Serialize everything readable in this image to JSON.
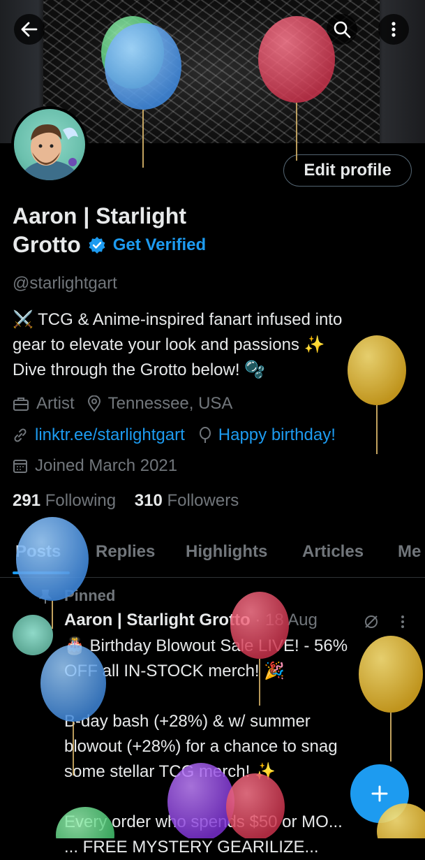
{
  "header": {
    "back_icon": "arrow-left-icon",
    "search_icon": "search-icon",
    "more_icon": "more-vertical-icon"
  },
  "profile": {
    "edit_label": "Edit profile",
    "name_line1": "Aaron | Starlight",
    "name_line2": "Grotto",
    "get_verified": "Get Verified",
    "handle": "@starlightgart",
    "bio": [
      "⚔️ TCG & Anime-inspired fanart infused into",
      "gear to elevate your look and passions ✨",
      "Dive through the Grotto below! 🫧"
    ],
    "occupation": "Artist",
    "location": "Tennessee, USA",
    "website": "linktr.ee/starlightgart",
    "birthday": "Happy birthday!",
    "joined": "Joined March 2021",
    "following_count": "291",
    "following_label": "Following",
    "followers_count": "310",
    "followers_label": "Followers"
  },
  "tabs": [
    "Posts",
    "Replies",
    "Highlights",
    "Articles",
    "Me"
  ],
  "active_tab": "Posts",
  "pinned_post": {
    "pinned_label": "Pinned",
    "author": "Aaron | Starlight Grotto",
    "date": "· 18 Aug",
    "text": "🎂 Birthday Blowout Sale LIVE! - 56%\nOFF all IN-STOCK merch! 🎉\n\nB-day bash (+28%) & w/ summer\nblowout (+28%) for a chance to snag\nsome stellar TCG merch! ✨\n\nEvery order who spends $50 or MO...\n... FREE MYSTERY GEARILIZE..."
  },
  "fab_icon": "plus-icon",
  "colors": {
    "accent": "#1d9bf0",
    "background": "#000000",
    "text": "#e7e9ea",
    "muted": "#71767b"
  }
}
